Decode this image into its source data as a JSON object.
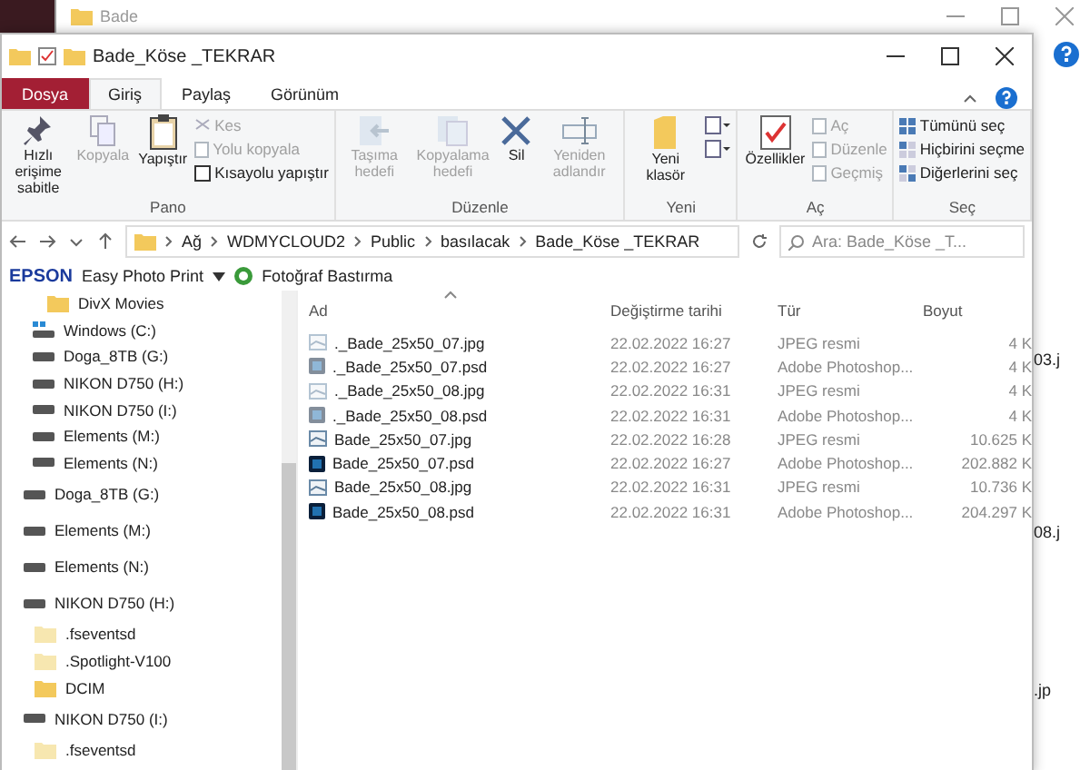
{
  "background_window": {
    "title": "Bade",
    "file_fragments": [
      "03.j",
      "08.j",
      ".jp"
    ]
  },
  "window": {
    "title": "Bade_Köse _TEKRAR"
  },
  "tabs": [
    {
      "label": "Dosya",
      "kind": "file",
      "selected": false
    },
    {
      "label": "Giriş",
      "kind": "tab",
      "selected": true
    },
    {
      "label": "Paylaş",
      "kind": "tab",
      "selected": false
    },
    {
      "label": "Görünüm",
      "kind": "tab",
      "selected": false
    }
  ],
  "ribbon": {
    "groups": [
      {
        "label": "Pano",
        "items": [
          {
            "kind": "large",
            "label": "Hızlı erişime sabitle",
            "disabled": false
          },
          {
            "kind": "large",
            "label": "Kopyala",
            "disabled": true
          },
          {
            "kind": "large",
            "label": "Yapıştır",
            "disabled": false
          },
          {
            "kind": "stack",
            "items": [
              {
                "label": "Kes",
                "disabled": true
              },
              {
                "label": "Yolu kopyala",
                "disabled": true
              },
              {
                "label": "Kısayolu yapıştır",
                "disabled": false
              }
            ]
          }
        ]
      },
      {
        "label": "Düzenle",
        "items": [
          {
            "kind": "large",
            "label": "Taşıma hedefi",
            "disabled": true
          },
          {
            "kind": "large",
            "label": "Kopyalama hedefi",
            "disabled": true
          },
          {
            "kind": "large",
            "label": "Sil",
            "disabled": false
          },
          {
            "kind": "large",
            "label": "Yeniden adlandır",
            "disabled": true
          }
        ]
      },
      {
        "label": "Yeni",
        "items": [
          {
            "kind": "large",
            "label": "Yeni klasör",
            "disabled": false
          },
          {
            "kind": "icon_stack"
          }
        ]
      },
      {
        "label": "Aç",
        "items": [
          {
            "kind": "large",
            "label": "Özellikler",
            "disabled": false
          },
          {
            "kind": "stack",
            "items": [
              {
                "label": "Aç",
                "disabled": true
              },
              {
                "label": "Düzenle",
                "disabled": true
              },
              {
                "label": "Geçmiş",
                "disabled": true
              }
            ]
          }
        ]
      },
      {
        "label": "Seç",
        "items": [
          {
            "kind": "stack",
            "items": [
              {
                "label": "Tümünü seç",
                "disabled": false
              },
              {
                "label": "Hiçbirini seçme",
                "disabled": false
              },
              {
                "label": "Diğerlerini seç",
                "disabled": false
              }
            ]
          }
        ]
      }
    ]
  },
  "address": {
    "path": [
      "Ağ",
      "WDMYCLOUD2",
      "Public",
      "basılacak",
      "Bade_Köse _TEKRAR"
    ],
    "search_placeholder": "Ara: Bade_Köse _T..."
  },
  "toolbar": {
    "brand": "EPSON",
    "app": "Easy Photo Print",
    "action": "Fotoğraf Bastırma"
  },
  "sidebar": {
    "open_folder_items": [
      {
        "label": "DivX Movies",
        "kind": "folder"
      },
      {
        "label": "Windows (C:)",
        "kind": "system"
      },
      {
        "label": "Doga_8TB (G:)",
        "kind": "drive"
      },
      {
        "label": "NIKON D750 (H:)",
        "kind": "drive"
      },
      {
        "label": "NIKON D750 (I:)",
        "kind": "drive"
      },
      {
        "label": "Elements (M:)",
        "kind": "drive"
      },
      {
        "label": "Elements (N:)",
        "kind": "drive"
      }
    ],
    "items": [
      {
        "label": "Doga_8TB (G:)",
        "kind": "drive"
      },
      {
        "label": "Elements (M:)",
        "kind": "drive"
      },
      {
        "label": "Elements (N:)",
        "kind": "drive"
      },
      {
        "label": "NIKON D750 (H:)",
        "kind": "drive",
        "children": [
          {
            "label": ".fseventsd",
            "kind": "hidden-folder"
          },
          {
            "label": ".Spotlight-V100",
            "kind": "hidden-folder"
          },
          {
            "label": "DCIM",
            "kind": "folder"
          }
        ]
      },
      {
        "label": "NIKON D750 (I:)",
        "kind": "drive",
        "children": [
          {
            "label": ".fseventsd",
            "kind": "hidden-folder"
          }
        ]
      }
    ]
  },
  "table": {
    "columns": [
      "Ad",
      "Değiştirme tarihi",
      "Tür",
      "Boyut"
    ],
    "rows": [
      {
        "name": "._Bade_25x50_07.jpg",
        "date": "22.02.2022 16:27",
        "type": "JPEG resmi",
        "size": "4 K",
        "kind": "jpg",
        "hidden": true
      },
      {
        "name": "._Bade_25x50_07.psd",
        "date": "22.02.2022 16:27",
        "type": "Adobe Photoshop...",
        "size": "4 K",
        "kind": "psd",
        "hidden": true
      },
      {
        "name": "._Bade_25x50_08.jpg",
        "date": "22.02.2022 16:31",
        "type": "JPEG resmi",
        "size": "4 K",
        "kind": "jpg",
        "hidden": true
      },
      {
        "name": "._Bade_25x50_08.psd",
        "date": "22.02.2022 16:31",
        "type": "Adobe Photoshop...",
        "size": "4 K",
        "kind": "psd",
        "hidden": true
      },
      {
        "name": "Bade_25x50_07.jpg",
        "date": "22.02.2022 16:28",
        "type": "JPEG resmi",
        "size": "10.625 K",
        "kind": "jpg",
        "hidden": false
      },
      {
        "name": "Bade_25x50_07.psd",
        "date": "22.02.2022 16:27",
        "type": "Adobe Photoshop...",
        "size": "202.882 K",
        "kind": "psd",
        "hidden": false
      },
      {
        "name": "Bade_25x50_08.jpg",
        "date": "22.02.2022 16:31",
        "type": "JPEG resmi",
        "size": "10.736 K",
        "kind": "jpg",
        "hidden": false
      },
      {
        "name": "Bade_25x50_08.psd",
        "date": "22.02.2022 16:31",
        "type": "Adobe Photoshop...",
        "size": "204.297 K",
        "kind": "psd",
        "hidden": false
      }
    ]
  }
}
